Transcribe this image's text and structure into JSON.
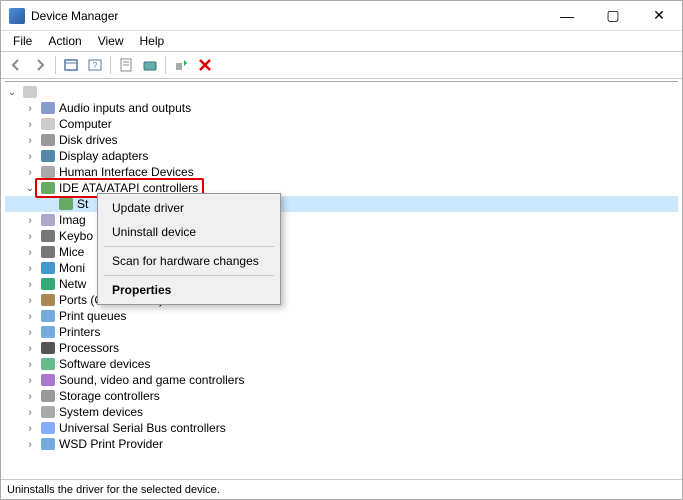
{
  "window": {
    "title": "Device Manager"
  },
  "menu": {
    "file": "File",
    "action": "Action",
    "view": "View",
    "help": "Help"
  },
  "tree": {
    "root": "",
    "items": [
      {
        "label": "Audio inputs and outputs",
        "icon": "ico-audio"
      },
      {
        "label": "Computer",
        "icon": "ico-pc"
      },
      {
        "label": "Disk drives",
        "icon": "ico-drv"
      },
      {
        "label": "Display adapters",
        "icon": "ico-disp"
      },
      {
        "label": "Human Interface Devices",
        "icon": "ico-hid"
      },
      {
        "label": "IDE ATA/ATAPI controllers",
        "icon": "ico-ide",
        "expanded": true,
        "highlighted": true,
        "children": [
          {
            "label": "St",
            "icon": "ico-ide",
            "selected": true
          }
        ]
      },
      {
        "label": "Imag",
        "icon": "ico-img"
      },
      {
        "label": "Keybo",
        "icon": "ico-kbd"
      },
      {
        "label": "Mice",
        "icon": "ico-mouse"
      },
      {
        "label": "Moni",
        "icon": "ico-mon"
      },
      {
        "label": "Netw",
        "icon": "ico-net"
      },
      {
        "label": "Ports (COM & LPT)",
        "icon": "ico-port"
      },
      {
        "label": "Print queues",
        "icon": "ico-prtq"
      },
      {
        "label": "Printers",
        "icon": "ico-prt"
      },
      {
        "label": "Processors",
        "icon": "ico-proc"
      },
      {
        "label": "Software devices",
        "icon": "ico-sw"
      },
      {
        "label": "Sound, video and game controllers",
        "icon": "ico-snd"
      },
      {
        "label": "Storage controllers",
        "icon": "ico-stor"
      },
      {
        "label": "System devices",
        "icon": "ico-sys"
      },
      {
        "label": "Universal Serial Bus controllers",
        "icon": "ico-usb"
      },
      {
        "label": "WSD Print Provider",
        "icon": "ico-wsd"
      }
    ]
  },
  "context_menu": {
    "update": "Update driver",
    "uninstall": "Uninstall device",
    "scan": "Scan for hardware changes",
    "properties": "Properties"
  },
  "statusbar": {
    "text": "Uninstalls the driver for the selected device."
  }
}
